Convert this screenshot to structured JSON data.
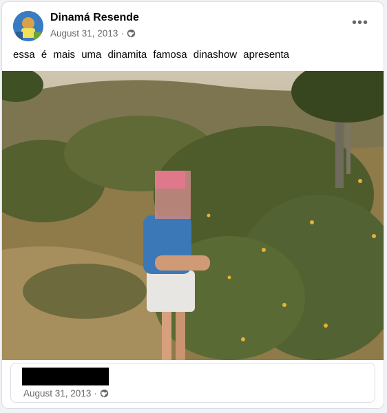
{
  "post": {
    "author": "Dinamá Resende",
    "date": "August 31, 2013",
    "date_separator": "·",
    "privacy_icon": "globe-icon",
    "more_icon": "more-options-icon",
    "more_glyph": "•••",
    "caption": "essa é mais uma dinamita famosa dinashow apresenta"
  },
  "shared_post": {
    "date": "August 31, 2013",
    "date_separator": "·",
    "privacy_icon": "globe-icon"
  }
}
